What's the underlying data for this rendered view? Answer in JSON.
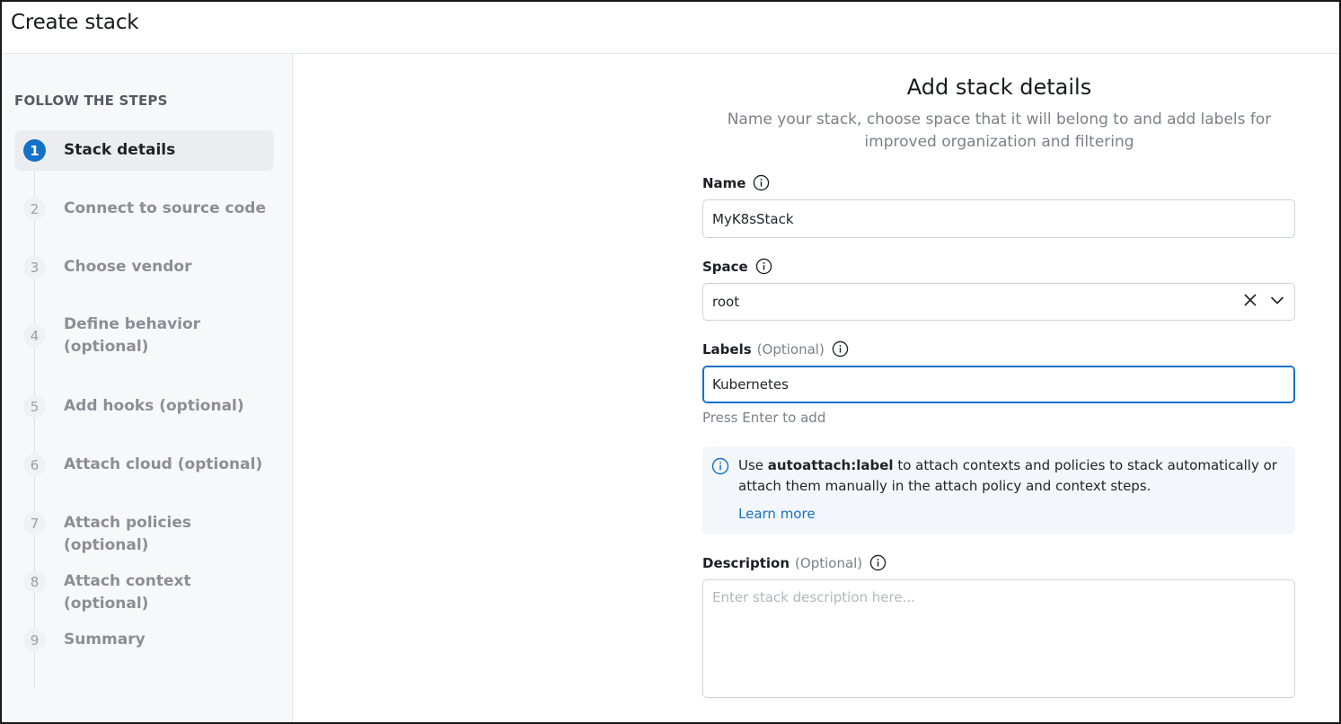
{
  "header": {
    "title": "Create stack"
  },
  "sidebar": {
    "title": "FOLLOW THE STEPS",
    "steps": [
      {
        "num": "1",
        "label": "Stack details",
        "active": true
      },
      {
        "num": "2",
        "label": "Connect to source code"
      },
      {
        "num": "3",
        "label": "Choose vendor"
      },
      {
        "num": "4",
        "label": "Define behavior (optional)"
      },
      {
        "num": "5",
        "label": "Add hooks (optional)"
      },
      {
        "num": "6",
        "label": "Attach cloud (optional)"
      },
      {
        "num": "7",
        "label": "Attach policies (optional)"
      },
      {
        "num": "8",
        "label": "Attach context (optional)"
      },
      {
        "num": "9",
        "label": "Summary"
      }
    ]
  },
  "form": {
    "title": "Add stack details",
    "subtitle": "Name your stack, choose space that it will belong to and add labels for improved organization and filtering",
    "name": {
      "label": "Name",
      "value": "MyK8sStack"
    },
    "space": {
      "label": "Space",
      "value": "root"
    },
    "labels": {
      "label": "Labels",
      "optional": "(Optional)",
      "value": "Kubernetes",
      "hint": "Press Enter to add"
    },
    "callout": {
      "prefix": "Use ",
      "bold": "autoattach:label",
      "suffix": " to attach contexts and policies to stack automatically or attach them manually in the attach policy and context steps.",
      "link": "Learn more"
    },
    "description": {
      "label": "Description",
      "optional": "(Optional)",
      "placeholder": "Enter stack description here..."
    }
  },
  "colors": {
    "accent": "#1570c9",
    "callout_bg": "#f3f7fb",
    "sidebar_bg": "#f7f8fa"
  },
  "icons": [
    "info-icon",
    "clear-icon",
    "chevron-down-icon"
  ]
}
